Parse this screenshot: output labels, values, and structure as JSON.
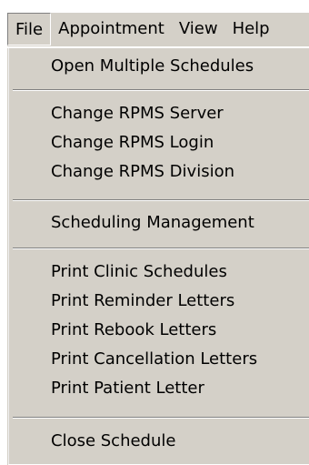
{
  "menubar": {
    "items": [
      {
        "label": "File"
      },
      {
        "label": "Appointment"
      },
      {
        "label": "View"
      },
      {
        "label": "Help"
      }
    ]
  },
  "file_menu": {
    "open_multiple": "Open Multiple Schedules",
    "change_server": "Change RPMS Server",
    "change_login": "Change RPMS Login",
    "change_division": "Change RPMS Division",
    "scheduling_management": "Scheduling Management",
    "print_clinic": "Print Clinic Schedules",
    "print_reminder": "Print Reminder Letters",
    "print_rebook": "Print Rebook Letters",
    "print_cancellation": "Print Cancellation Letters",
    "print_patient": "Print Patient Letter",
    "close_schedule": "Close Schedule"
  }
}
